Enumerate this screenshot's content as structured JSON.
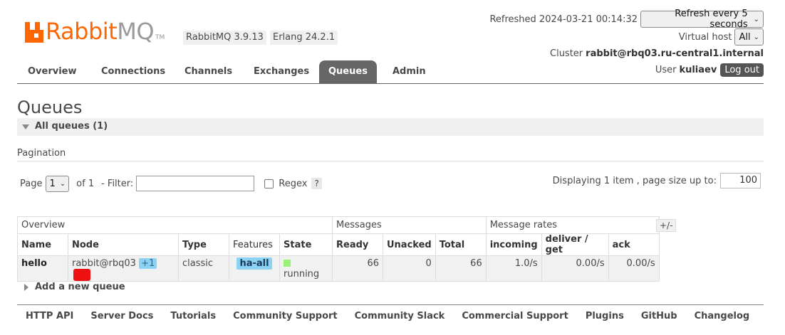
{
  "brand": {
    "logo_r": "Rabbit",
    "logo_mq": "MQ",
    "logo_tm": "TM"
  },
  "versions": {
    "rabbitmq": "RabbitMQ 3.9.13",
    "erlang": "Erlang 24.2.1"
  },
  "header": {
    "refreshed": "Refreshed 2024-03-21 00:14:32",
    "refresh_select": "Refresh every 5 seconds",
    "vhost_label": "Virtual host",
    "vhost_select": "All",
    "cluster_label": "Cluster",
    "cluster_name": "rabbit@rbq03.ru-central1.internal",
    "user_label": "User",
    "user_name": "kuliaev",
    "logout": "Log out"
  },
  "tabs": [
    "Overview",
    "Connections",
    "Channels",
    "Exchanges",
    "Queues",
    "Admin"
  ],
  "active_tab": "Queues",
  "page": {
    "title": "Queues",
    "section": "All queues (1)"
  },
  "pagination": {
    "title": "Pagination",
    "page_label": "Page",
    "page_value": "1",
    "of_label": "of 1",
    "filter_label": "- Filter:",
    "filter_value": "",
    "regex_label": "Regex",
    "help": "?",
    "displaying": "Displaying 1 item , page size up to:",
    "page_size": "100"
  },
  "table": {
    "groups": {
      "overview": "Overview",
      "messages": "Messages",
      "rates": "Message rates"
    },
    "columns": [
      "Name",
      "Node",
      "Type",
      "Features",
      "State",
      "Ready",
      "Unacked",
      "Total",
      "incoming",
      "deliver / get",
      "ack"
    ],
    "toggle": "+/-",
    "rows": [
      {
        "name": "hello",
        "node": "rabbit@rbq03",
        "mirrors": "+1",
        "type": "classic",
        "features": "ha-all",
        "state": "running",
        "ready": "66",
        "unacked": "0",
        "total": "66",
        "incoming": "1.0/s",
        "deliver_get": "0.00/s",
        "ack": "0.00/s"
      }
    ]
  },
  "add_queue": "Add a new queue",
  "footer": [
    "HTTP API",
    "Server Docs",
    "Tutorials",
    "Community Support",
    "Community Slack",
    "Commercial Support",
    "Plugins",
    "GitHub",
    "Changelog"
  ],
  "colors": {
    "accent": "#ff6600",
    "tab_active": "#666666",
    "badge_blue": "#8cd2f2",
    "state_green": "#98f273",
    "node_down": "#ee1111"
  }
}
